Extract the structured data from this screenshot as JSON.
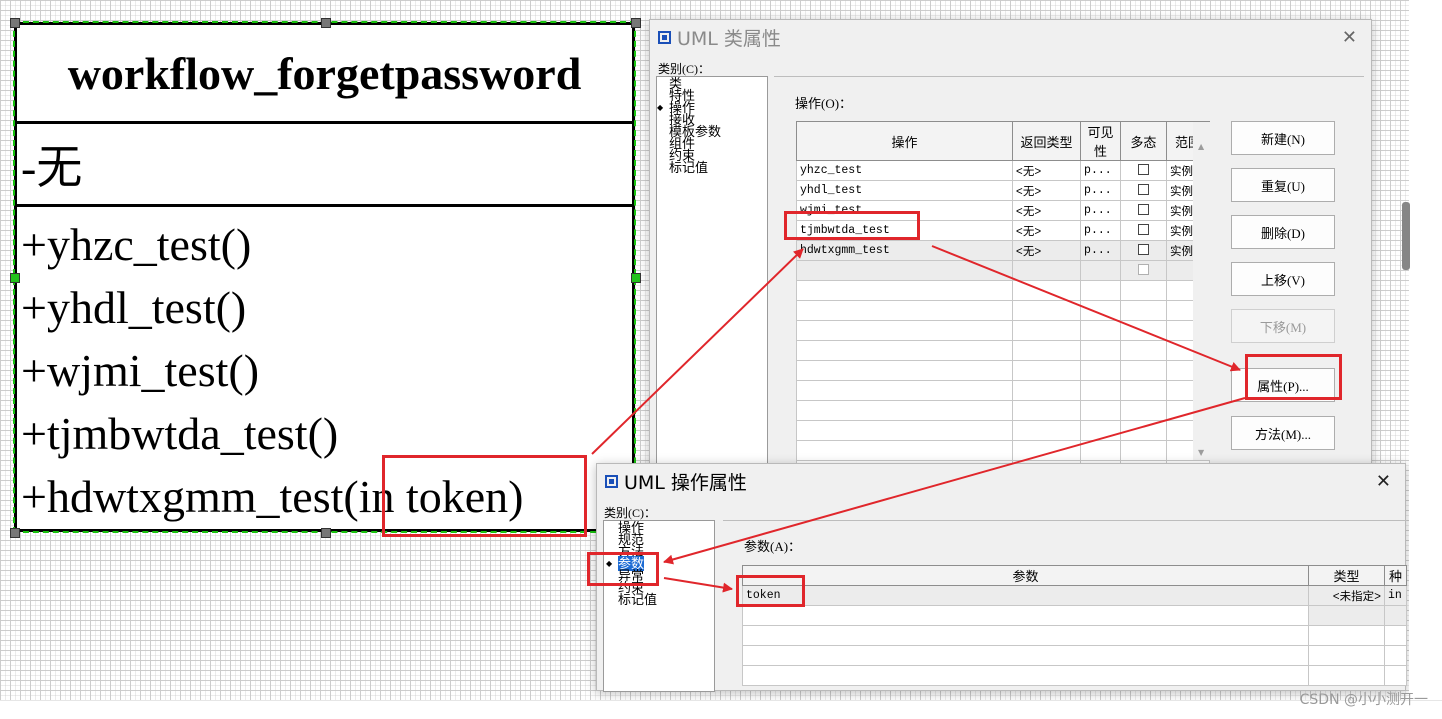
{
  "uml_class": {
    "name": "workflow_forgetpassword",
    "attribute": "-无",
    "operations": [
      "+yhzc_test()",
      "+yhdl_test()",
      "+wjmi_test()",
      "+tjmbwtda_test()",
      "+hdwtxgmm_test(in token)"
    ]
  },
  "class_props_window": {
    "title": "UML 类属性",
    "close_glyph": "✕",
    "category_label": "类别(C)：",
    "categories": [
      "类",
      "特性",
      "操作",
      "接收",
      "模板参数",
      "组件",
      "约束",
      "标记值"
    ],
    "ops_label": "操作(O)：",
    "columns": [
      "操作",
      "返回类型",
      "可见性",
      "多态",
      "范围"
    ],
    "rows": [
      {
        "name": "yhzc_test",
        "return": "<无>",
        "visibility": "p...",
        "scope": "实例"
      },
      {
        "name": "yhdl_test",
        "return": "<无>",
        "visibility": "p...",
        "scope": "实例"
      },
      {
        "name": "wjmi_test",
        "return": "<无>",
        "visibility": "p...",
        "scope": "实例"
      },
      {
        "name": "tjmbwtda_test",
        "return": "<无>",
        "visibility": "p...",
        "scope": "实例"
      },
      {
        "name": "hdwtxgmm_test",
        "return": "<无>",
        "visibility": "p...",
        "scope": "实例"
      }
    ],
    "buttons": {
      "new": "新建(N)",
      "duplicate": "重复(U)",
      "delete": "删除(D)",
      "move_up": "上移(V)",
      "move_down": "下移(M)",
      "properties": "属性(P)...",
      "methods": "方法(M)..."
    }
  },
  "op_props_window": {
    "title": "UML 操作属性",
    "close_glyph": "✕",
    "category_label": "类别(C)：",
    "categories": [
      "操作",
      "规范",
      "方法",
      "参数",
      "异常",
      "约束",
      "标记值"
    ],
    "params_label": "参数(A)：",
    "columns": [
      "参数",
      "类型",
      "种"
    ],
    "rows": [
      {
        "name": "token",
        "type": "<未指定>",
        "kind": "in"
      }
    ]
  },
  "watermark": "CSDN @小小测开一",
  "colors": {
    "annotation_red": "#e0262b",
    "selection_blue": "#1c6bd4",
    "handle_green": "#23c21b"
  }
}
